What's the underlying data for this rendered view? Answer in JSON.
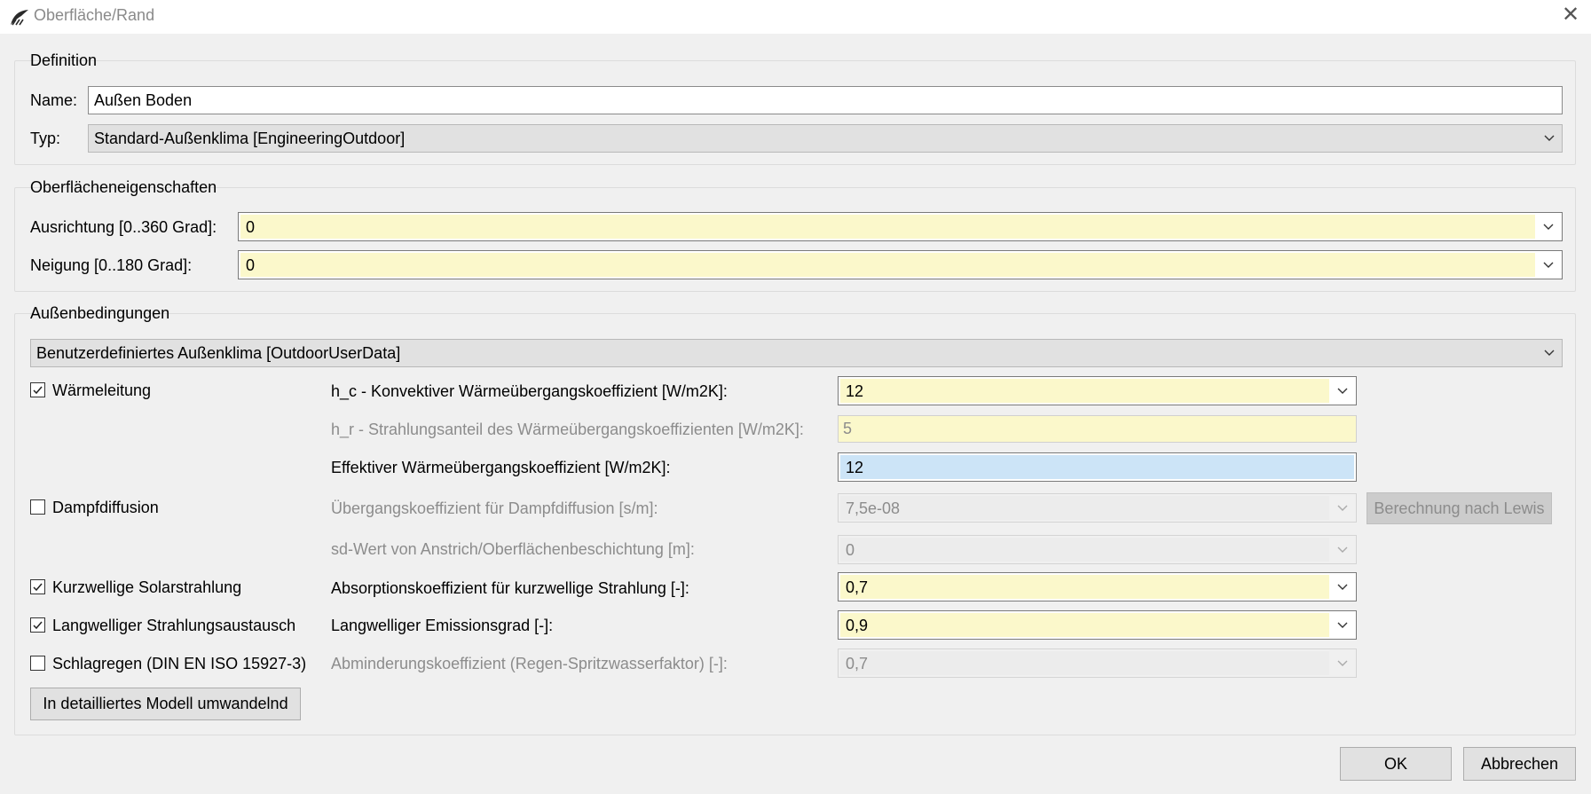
{
  "window": {
    "title": "Oberfläche/Rand"
  },
  "definition": {
    "group_title": "Definition",
    "name_label": "Name:",
    "name_value": "Außen Boden",
    "type_label": "Typ:",
    "type_value": "Standard-Außenklima [EngineeringOutdoor]"
  },
  "surface": {
    "group_title": "Oberflächeneigenschaften",
    "orientation_label": "Ausrichtung [0..360 Grad]:",
    "orientation_value": "0",
    "inclination_label": "Neigung [0..180 Grad]:",
    "inclination_value": "0"
  },
  "outdoor": {
    "group_title": "Außenbedingungen",
    "climate_value": "Benutzerdefiniertes Außenklima [OutdoorUserData]",
    "heat_conduction": {
      "checkbox_label": "Wärmeleitung",
      "checked": true,
      "hc_label": "h_c - Konvektiver Wärmeübergangskoeffizient [W/m2K]:",
      "hc_value": "12",
      "hr_label": "h_r - Strahlungsanteil des Wärmeübergangskoeffizienten [W/m2K]:",
      "hr_value": "5",
      "eff_label": "Effektiver Wärmeübergangskoeffizient [W/m2K]:",
      "eff_value": "12"
    },
    "vapor": {
      "checkbox_label": "Dampfdiffusion",
      "checked": false,
      "coef_label": "Übergangskoeffizient für Dampfdiffusion [s/m]:",
      "coef_value": "7,5e-08",
      "lewis_button": "Berechnung nach Lewis",
      "sd_label": "sd-Wert von Anstrich/Oberflächenbeschichtung [m]:",
      "sd_value": "0"
    },
    "solar": {
      "checkbox_label": "Kurzwellige Solarstrahlung",
      "checked": true,
      "abs_label": "Absorptionskoeffizient für kurzwellige Strahlung [-]:",
      "abs_value": "0,7"
    },
    "longwave": {
      "checkbox_label": "Langwelliger Strahlungsaustausch",
      "checked": true,
      "emis_label": "Langwelliger Emissionsgrad [-]:",
      "emis_value": "0,9"
    },
    "rain": {
      "checkbox_label": "Schlagregen (DIN EN ISO 15927-3)",
      "checked": false,
      "red_label": "Abminderungskoeffizient (Regen-Spritzwasserfaktor) [-]:",
      "red_value": "0,7"
    },
    "convert_button": "In detailliertes Modell umwandelnd"
  },
  "footer": {
    "ok": "OK",
    "cancel": "Abbrechen"
  },
  "icons": {
    "app": "app-icon",
    "close": "close-icon",
    "dropdown": "chevron-down-icon",
    "check": "checkmark-icon"
  }
}
